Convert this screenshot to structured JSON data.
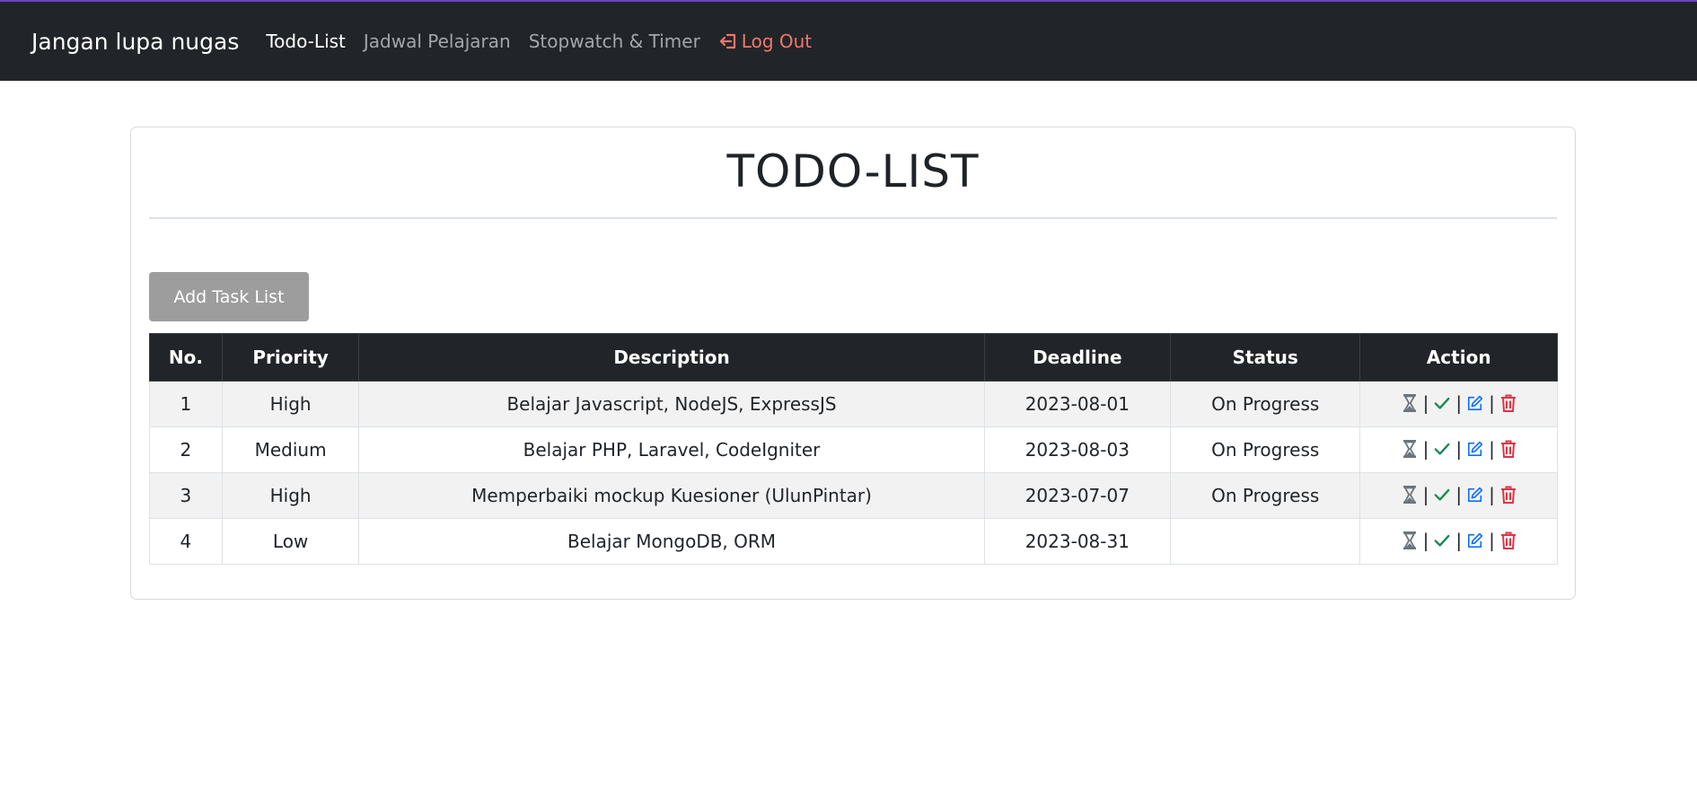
{
  "navbar": {
    "brand": "Jangan lupa nugas",
    "links": [
      {
        "label": "Todo-List"
      },
      {
        "label": "Jadwal Pelajaran"
      },
      {
        "label": "Stopwatch & Timer"
      }
    ],
    "logout_label": "Log Out"
  },
  "main": {
    "title": "TODO-LIST",
    "add_button_label": "Add Task List",
    "table": {
      "headers": [
        "No.",
        "Priority",
        "Description",
        "Deadline",
        "Status",
        "Action"
      ],
      "rows": [
        {
          "no": "1",
          "priority": "High",
          "description": "Belajar Javascript, NodeJS, ExpressJS",
          "deadline": "2023-08-01",
          "status": "On Progress"
        },
        {
          "no": "2",
          "priority": "Medium",
          "description": "Belajar PHP, Laravel, CodeIgniter",
          "deadline": "2023-08-03",
          "status": "On Progress"
        },
        {
          "no": "3",
          "priority": "High",
          "description": "Memperbaiki mockup Kuesioner (UlunPintar)",
          "deadline": "2023-07-07",
          "status": "On Progress"
        },
        {
          "no": "4",
          "priority": "Low",
          "description": "Belajar MongoDB, ORM",
          "deadline": "2023-08-31",
          "status": ""
        }
      ],
      "action_separator": "|",
      "action_icons": [
        "hourglass-icon",
        "check-icon",
        "edit-icon",
        "trash-icon"
      ]
    }
  },
  "colors": {
    "navbar_bg": "#212529",
    "logout": "#f2766b",
    "button_bg": "#9d9d9d",
    "check": "#198754",
    "edit": "#0d6efd",
    "trash": "#dc3545",
    "hourglass": "#6c757d"
  }
}
